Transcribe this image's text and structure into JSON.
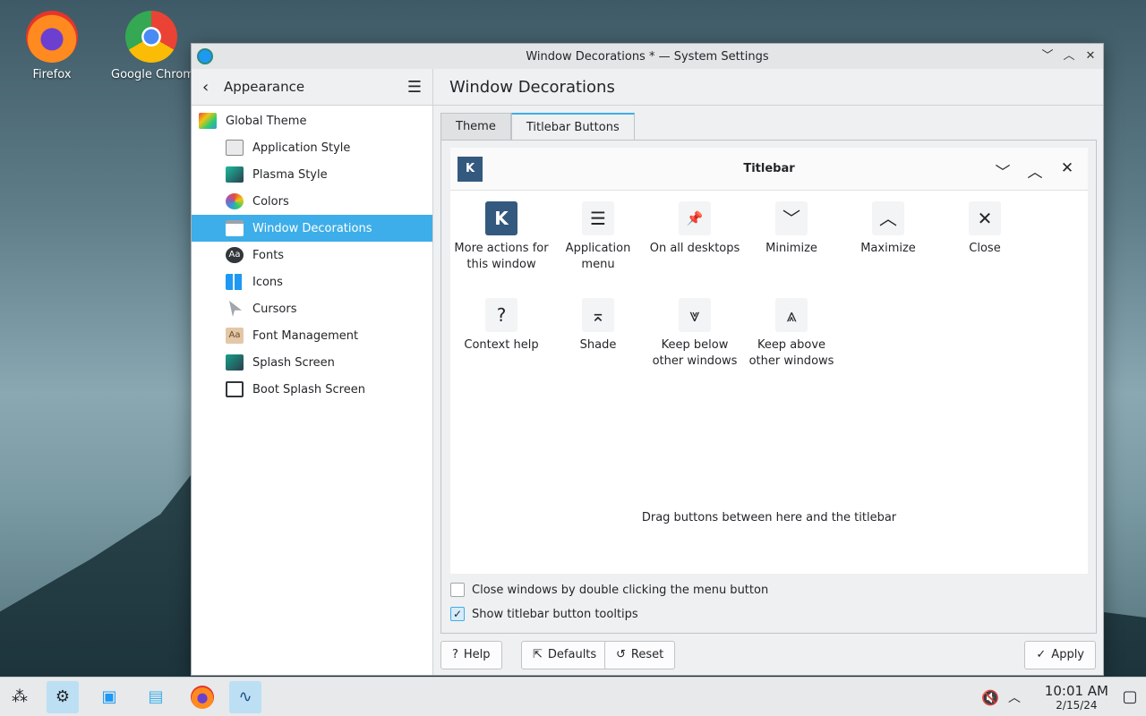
{
  "desktop": {
    "icons": [
      {
        "label": "Firefox",
        "icon": "firefox-icon"
      },
      {
        "label": "Google Chrom",
        "icon": "chrome-icon"
      }
    ]
  },
  "window": {
    "title": "Window Decorations * — System Settings"
  },
  "sidebar": {
    "header": "Appearance",
    "items": [
      {
        "label": "Global Theme",
        "icon": "global-theme-icon",
        "level": "top"
      },
      {
        "label": "Application Style",
        "icon": "application-style-icon",
        "level": "sub"
      },
      {
        "label": "Plasma Style",
        "icon": "plasma-style-icon",
        "level": "sub"
      },
      {
        "label": "Colors",
        "icon": "colors-icon",
        "level": "sub"
      },
      {
        "label": "Window Decorations",
        "icon": "window-decorations-icon",
        "level": "sub",
        "active": true
      },
      {
        "label": "Fonts",
        "icon": "fonts-icon",
        "level": "sub"
      },
      {
        "label": "Icons",
        "icon": "icons-icon",
        "level": "sub"
      },
      {
        "label": "Cursors",
        "icon": "cursors-icon",
        "level": "sub"
      },
      {
        "label": "Font Management",
        "icon": "font-management-icon",
        "level": "sub"
      },
      {
        "label": "Splash Screen",
        "icon": "splash-screen-icon",
        "level": "sub"
      },
      {
        "label": "Boot Splash Screen",
        "icon": "boot-splash-screen-icon",
        "level": "sub"
      }
    ]
  },
  "main": {
    "title": "Window Decorations",
    "tabs": [
      {
        "label": "Theme"
      },
      {
        "label": "Titlebar Buttons",
        "active": true
      }
    ],
    "preview": {
      "title": "Titlebar",
      "logo": "K"
    },
    "available_buttons": [
      {
        "label": "More actions for this window",
        "glyph": "K",
        "icon": "kde-menu-icon"
      },
      {
        "label": "Application menu",
        "glyph": "☰",
        "icon": "hamburger-menu-icon"
      },
      {
        "label": "On all desktops",
        "glyph": "📌",
        "icon": "pin-icon"
      },
      {
        "label": "Minimize",
        "glyph": "﹀",
        "icon": "minimize-icon"
      },
      {
        "label": "Maximize",
        "glyph": "︿",
        "icon": "maximize-icon"
      },
      {
        "label": "Close",
        "glyph": "✕",
        "icon": "close-icon"
      },
      {
        "label": "Context help",
        "glyph": "?",
        "icon": "help-icon"
      },
      {
        "label": "Shade",
        "glyph": "⌅",
        "icon": "shade-icon"
      },
      {
        "label": "Keep below other windows",
        "glyph": "⩔",
        "icon": "keep-below-icon"
      },
      {
        "label": "Keep above other windows",
        "glyph": "⩓",
        "icon": "keep-above-icon"
      }
    ],
    "drop_hint": "Drag buttons between here and the titlebar",
    "checkboxes": [
      {
        "label": "Close windows by double clicking the menu button",
        "checked": false
      },
      {
        "label": "Show titlebar button tooltips",
        "checked": true
      }
    ]
  },
  "footer": {
    "help": "Help",
    "defaults": "Defaults",
    "reset": "Reset",
    "apply": "Apply"
  },
  "taskbar": {
    "time": "10:01 AM",
    "date": "2/15/24"
  },
  "colors": {
    "accent": "#3daee9",
    "kde_blue": "#34597e"
  }
}
